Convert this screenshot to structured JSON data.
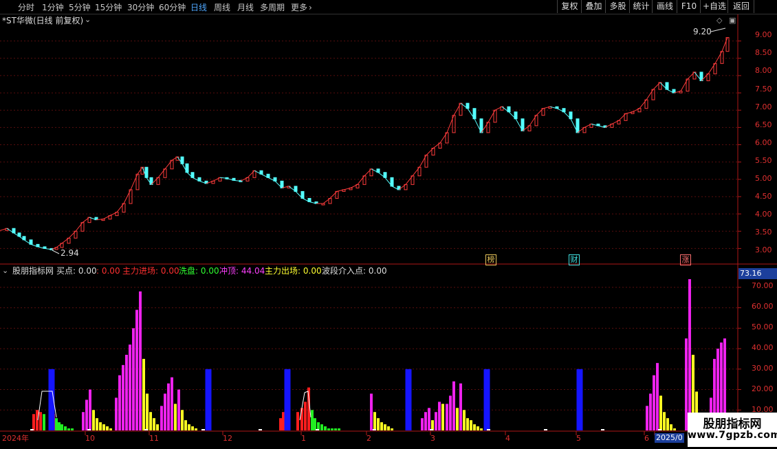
{
  "topbar": {
    "periods": [
      "分时",
      "1分钟",
      "5分钟",
      "15分钟",
      "30分钟",
      "60分钟",
      "日线",
      "周线",
      "月线",
      "多周期",
      "更多"
    ],
    "active_period": "日线",
    "more_arrow": "›",
    "right_buttons": [
      "复权",
      "叠加",
      "多股",
      "统计",
      "画线",
      "F10",
      "+自选",
      "返回"
    ]
  },
  "main_chart": {
    "title": "*ST华微(日线 前复权)",
    "price_ticks": [
      "9.00",
      "8.50",
      "8.00",
      "7.50",
      "7.00",
      "6.50",
      "6.00",
      "5.50",
      "5.00",
      "4.50",
      "4.00",
      "3.50",
      "3.00"
    ],
    "high_label": "9.20",
    "low_label": "2.94",
    "markers": [
      "榜",
      "财",
      "涨"
    ],
    "colors": {
      "up": "#ff3c3c",
      "down": "#54ffff",
      "grid": "#6a1010",
      "axis": "#b01818"
    }
  },
  "indicator": {
    "name": "股朋指标网",
    "items": [
      {
        "label": "买点",
        "value": "0.00",
        "color": "#dddddd"
      },
      {
        "label": "",
        "value": "0.00",
        "color": "#ff3030"
      },
      {
        "label": "主力进场",
        "value": "0.00",
        "color": "#ff3030"
      },
      {
        "label": "洗盘",
        "value": "0.00",
        "color": "#30ff30"
      },
      {
        "label": "冲顶",
        "value": "44.04",
        "color": "#ff40ff"
      },
      {
        "label": "主力出场",
        "value": "0.00",
        "color": "#ffff30"
      },
      {
        "label": "波段介入点",
        "value": "0.00",
        "color": "#dddddd"
      }
    ],
    "current_value": "73.16",
    "y_ticks": [
      "70.00",
      "60.00",
      "50.00",
      "40.00",
      "30.00",
      "20.00",
      "10.00"
    ],
    "ylim": [
      0,
      75
    ]
  },
  "xaxis": {
    "labels": [
      "2024年",
      "10",
      "11",
      "12",
      "1",
      "2",
      "3",
      "4",
      "5",
      "6",
      "2025/0"
    ]
  },
  "watermark": {
    "title": "股朋指标网",
    "url": "www.7gpzb.com"
  },
  "chart_data": [
    {
      "type": "candlestick",
      "title": "*ST华微(日线 前复权)",
      "ylim": [
        2.65,
        9.45
      ],
      "y_ticks": [
        3.0,
        3.5,
        4.0,
        4.5,
        5.0,
        5.5,
        6.0,
        6.5,
        7.0,
        7.5,
        8.0,
        8.5,
        9.0
      ],
      "annotations": [
        {
          "text": "9.20",
          "value": 9.2
        },
        {
          "text": "2.94",
          "value": 2.94
        }
      ],
      "close_path": [
        [
          0,
          3.52
        ],
        [
          10,
          3.58
        ],
        [
          20,
          3.45
        ],
        [
          28,
          3.35
        ],
        [
          35,
          3.25
        ],
        [
          45,
          3.12
        ],
        [
          55,
          3.05
        ],
        [
          65,
          3.0
        ],
        [
          75,
          2.97
        ],
        [
          82,
          3.03
        ],
        [
          90,
          3.15
        ],
        [
          100,
          3.3
        ],
        [
          110,
          3.5
        ],
        [
          120,
          3.75
        ],
        [
          130,
          3.9
        ],
        [
          140,
          3.83
        ],
        [
          150,
          3.85
        ],
        [
          160,
          3.95
        ],
        [
          170,
          4.05
        ],
        [
          180,
          4.3
        ],
        [
          190,
          4.7
        ],
        [
          200,
          5.15
        ],
        [
          207,
          5.35
        ],
        [
          213,
          5.05
        ],
        [
          220,
          4.85
        ],
        [
          230,
          5.05
        ],
        [
          240,
          5.3
        ],
        [
          250,
          5.55
        ],
        [
          258,
          5.65
        ],
        [
          265,
          5.45
        ],
        [
          272,
          5.2
        ],
        [
          280,
          5.05
        ],
        [
          290,
          4.95
        ],
        [
          300,
          4.88
        ],
        [
          310,
          4.95
        ],
        [
          320,
          5.05
        ],
        [
          330,
          5.03
        ],
        [
          340,
          4.97
        ],
        [
          350,
          4.95
        ],
        [
          360,
          5.05
        ],
        [
          370,
          5.25
        ],
        [
          380,
          5.15
        ],
        [
          390,
          5.05
        ],
        [
          400,
          4.95
        ],
        [
          410,
          4.75
        ],
        [
          420,
          4.8
        ],
        [
          430,
          4.65
        ],
        [
          440,
          4.45
        ],
        [
          450,
          4.35
        ],
        [
          460,
          4.3
        ],
        [
          470,
          4.3
        ],
        [
          480,
          4.45
        ],
        [
          490,
          4.65
        ],
        [
          500,
          4.7
        ],
        [
          510,
          4.75
        ],
        [
          520,
          4.85
        ],
        [
          530,
          5.1
        ],
        [
          540,
          5.3
        ],
        [
          550,
          5.2
        ],
        [
          560,
          5.05
        ],
        [
          570,
          4.8
        ],
        [
          580,
          4.7
        ],
        [
          590,
          4.85
        ],
        [
          600,
          5.1
        ],
        [
          610,
          5.35
        ],
        [
          620,
          5.7
        ],
        [
          630,
          5.9
        ],
        [
          640,
          6.05
        ],
        [
          650,
          6.35
        ],
        [
          660,
          6.85
        ],
        [
          670,
          7.2
        ],
        [
          680,
          7.05
        ],
        [
          690,
          6.75
        ],
        [
          700,
          6.35
        ],
        [
          710,
          6.65
        ],
        [
          720,
          7.0
        ],
        [
          730,
          7.1
        ],
        [
          740,
          6.95
        ],
        [
          750,
          6.75
        ],
        [
          760,
          6.4
        ],
        [
          770,
          6.55
        ],
        [
          780,
          6.85
        ],
        [
          790,
          7.05
        ],
        [
          800,
          7.1
        ],
        [
          810,
          7.05
        ],
        [
          820,
          6.95
        ],
        [
          830,
          6.75
        ],
        [
          840,
          6.35
        ],
        [
          850,
          6.5
        ],
        [
          860,
          6.6
        ],
        [
          870,
          6.55
        ],
        [
          880,
          6.5
        ],
        [
          890,
          6.6
        ],
        [
          900,
          6.7
        ],
        [
          910,
          6.9
        ],
        [
          920,
          6.95
        ],
        [
          930,
          7.05
        ],
        [
          940,
          7.3
        ],
        [
          950,
          7.6
        ],
        [
          960,
          7.8
        ],
        [
          970,
          7.6
        ],
        [
          980,
          7.5
        ],
        [
          990,
          7.55
        ],
        [
          1000,
          7.9
        ],
        [
          1010,
          8.1
        ],
        [
          1020,
          7.85
        ],
        [
          1030,
          8.05
        ],
        [
          1040,
          8.35
        ],
        [
          1050,
          8.7
        ],
        [
          1058,
          9.1
        ]
      ]
    },
    {
      "type": "bar",
      "title": "股朋指标网",
      "ylim": [
        0,
        75
      ],
      "y_ticks": [
        10,
        20,
        30,
        40,
        50,
        60,
        70
      ],
      "series": [
        {
          "name": "主力进场",
          "color": "#ff1e1e",
          "bars": [
            [
              49,
              8
            ],
            [
              54,
              10
            ],
            [
              59,
              9
            ],
            [
              74,
              11
            ],
            [
              78,
              8
            ],
            [
              408,
              6
            ],
            [
              412,
              9
            ],
            [
              417,
              11
            ],
            [
              433,
              9
            ],
            [
              439,
              11
            ],
            [
              444,
              14
            ],
            [
              449,
              21
            ]
          ]
        },
        {
          "name": "洗盘",
          "color": "#22ee22",
          "bars": [
            [
              64,
              8
            ],
            [
              82,
              6
            ],
            [
              86,
              4
            ],
            [
              90,
              3
            ],
            [
              95,
              2
            ],
            [
              100,
              1
            ],
            [
              105,
              1
            ],
            [
              454,
              10
            ],
            [
              458,
              6
            ],
            [
              463,
              4
            ],
            [
              468,
              3
            ],
            [
              473,
              2
            ],
            [
              478,
              1
            ],
            [
              483,
              1
            ],
            [
              488,
              1
            ],
            [
              493,
              1
            ]
          ]
        },
        {
          "name": "冲顶",
          "color": "#ee22ee",
          "bars": [
            [
              121,
              9
            ],
            [
              126,
              15
            ],
            [
              131,
              20
            ],
            [
              169,
              16
            ],
            [
              174,
              27
            ],
            [
              179,
              32
            ],
            [
              184,
              37
            ],
            [
              189,
              42
            ],
            [
              194,
              50
            ],
            [
              199,
              59
            ],
            [
              204,
              68
            ],
            [
              235,
              12
            ],
            [
              240,
              18
            ],
            [
              245,
              23
            ],
            [
              250,
              26
            ],
            [
              260,
              20
            ],
            [
              540,
              18
            ],
            [
              614,
              6
            ],
            [
              619,
              9
            ],
            [
              624,
              11
            ],
            [
              634,
              9
            ],
            [
              639,
              14
            ],
            [
              650,
              13
            ],
            [
              655,
              17
            ],
            [
              660,
              24
            ],
            [
              670,
              23
            ],
            [
              941,
              12
            ],
            [
              946,
              18
            ],
            [
              951,
              27
            ],
            [
              956,
              33
            ],
            [
              998,
              45
            ],
            [
              1003,
              74
            ],
            [
              1034,
              16
            ],
            [
              1039,
              35
            ],
            [
              1044,
              40
            ],
            [
              1049,
              43
            ],
            [
              1054,
              45
            ]
          ]
        },
        {
          "name": "主力出场",
          "color": "#ffff22",
          "bars": [
            [
              136,
              10
            ],
            [
              141,
              6
            ],
            [
              146,
              4
            ],
            [
              151,
              3
            ],
            [
              156,
              2
            ],
            [
              161,
              1
            ],
            [
              209,
              35
            ],
            [
              214,
              18
            ],
            [
              219,
              9
            ],
            [
              224,
              6
            ],
            [
              229,
              3
            ],
            [
              255,
              13
            ],
            [
              265,
              10
            ],
            [
              270,
              5
            ],
            [
              275,
              3
            ],
            [
              280,
              2
            ],
            [
              285,
              1
            ],
            [
              545,
              9
            ],
            [
              550,
              6
            ],
            [
              555,
              4
            ],
            [
              560,
              3
            ],
            [
              565,
              2
            ],
            [
              570,
              1
            ],
            [
              629,
              5
            ],
            [
              644,
              13
            ],
            [
              665,
              11
            ],
            [
              675,
              10
            ],
            [
              680,
              6
            ],
            [
              685,
              5
            ],
            [
              690,
              3
            ],
            [
              695,
              2
            ],
            [
              700,
              1
            ],
            [
              961,
              17
            ],
            [
              966,
              9
            ],
            [
              971,
              6
            ],
            [
              976,
              3
            ],
            [
              981,
              1
            ],
            [
              1008,
              37
            ],
            [
              1013,
              19
            ],
            [
              1018,
              7
            ],
            [
              1023,
              3
            ],
            [
              1028,
              1
            ]
          ]
        },
        {
          "name": "波段介入点",
          "color": "#1515ff",
          "bars": [
            [
              75,
              30
            ],
            [
              303,
              30
            ],
            [
              418,
              30
            ],
            [
              594,
              30
            ],
            [
              708,
              30
            ],
            [
              843,
              30
            ]
          ]
        }
      ]
    }
  ]
}
